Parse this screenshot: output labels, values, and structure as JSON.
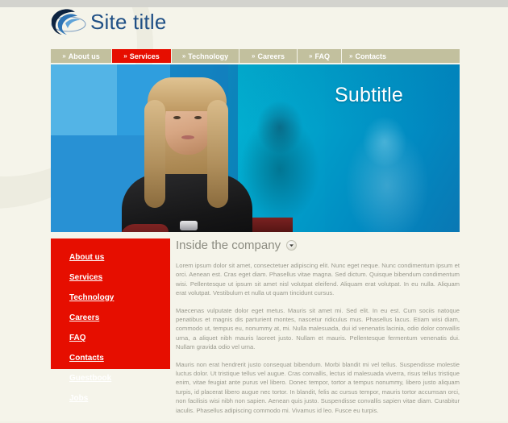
{
  "site": {
    "title": "Site title",
    "logo_icon": "swoosh-logo-icon"
  },
  "colors": {
    "accent_red": "#e60e00",
    "nav_bg": "#c2c09e",
    "page_bg": "#f5f4ea",
    "title_blue": "#1f4f85",
    "hero_blue": "#0b72ad",
    "body_text": "#9a9a8e",
    "heading_text": "#8d8d82"
  },
  "nav": {
    "prefix": "»",
    "items": [
      {
        "label": "About us",
        "active": false
      },
      {
        "label": "Services",
        "active": true
      },
      {
        "label": "Technology",
        "active": false
      },
      {
        "label": "Careers",
        "active": false
      },
      {
        "label": "FAQ",
        "active": false
      },
      {
        "label": "Contacts",
        "active": false
      }
    ]
  },
  "hero": {
    "subtitle": "Subtitle"
  },
  "sidebar": {
    "items": [
      {
        "label": "About us"
      },
      {
        "label": "Services"
      },
      {
        "label": "Technology"
      },
      {
        "label": "Careers"
      },
      {
        "label": "FAQ"
      },
      {
        "label": "Contacts"
      },
      {
        "label": "Guestbook"
      },
      {
        "label": "Jobs"
      }
    ]
  },
  "content": {
    "heading": "Inside the company",
    "toggle_icon": "chevron-down-icon",
    "paragraphs": [
      "Lorem ipsum dolor sit amet, consectetuer adipiscing elit. Nunc eget neque. Nunc condimentum ipsum et orci. Aenean est. Cras eget diam. Phasellus vitae magna. Sed dictum. Quisque bibendum condimentum wisi. Pellentesque ut ipsum sit amet nisl volutpat eleifend. Aliquam erat volutpat. In eu nulla. Aliquam erat volutpat. Vestibulum et nulla ut quam tincidunt cursus.",
      "Maecenas vulputate dolor eget metus. Mauris sit amet mi. Sed elit. In eu est. Cum sociis natoque penatibus et magnis dis parturient montes, nascetur ridiculus mus. Phasellus lacus. Etiam wisi diam, commodo ut, tempus eu, nonummy at, mi. Nulla malesuada, dui id venenatis lacinia, odio dolor convallis urna, a aliquet nibh mauris laoreet justo. Nullam et mauris. Pellentesque fermentum venenatis dui. Nullam gravida odio vel urna.",
      "Mauris non erat hendrerit justo consequat bibendum. Morbi blandit mi vel tellus. Suspendisse molestie luctus dolor. Ut tristique tellus vel augue. Cras convallis, lectus id malesuada viverra, risus tellus tristique enim, vitae feugiat ante purus vel libero. Donec tempor, tortor a tempus nonummy, libero justo aliquam turpis, id placerat libero augue nec tortor. In blandit, felis ac cursus tempor, mauris tortor accumsan orci, non facilisis wisi nibh non sapien. Aenean quis justo. Suspendisse convallis sapien vitae diam. Curabitur iaculis. Phasellus adipiscing commodo mi. Vivamus id leo. Fusce eu turpis."
    ]
  }
}
